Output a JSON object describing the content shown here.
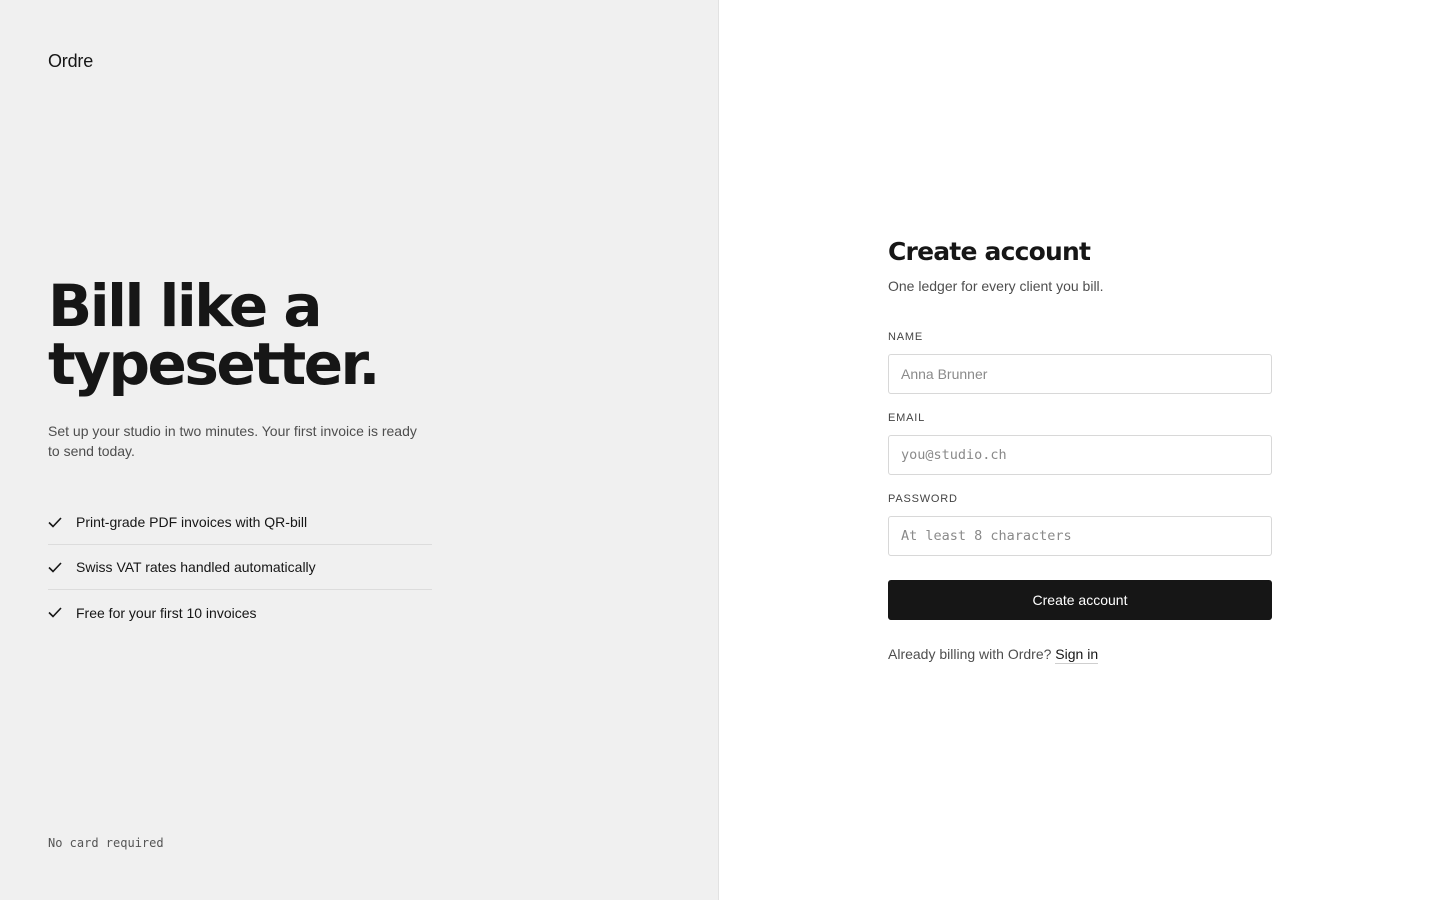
{
  "brand": {
    "name": "Ordre"
  },
  "hero": {
    "headline_line1": "Bill like a",
    "headline_line2": "typesetter.",
    "lede": "Set up your studio in two minutes. Your first invoice is ready to send today."
  },
  "features": [
    {
      "icon": "check-icon",
      "label": "Print-grade PDF invoices with QR-bill"
    },
    {
      "icon": "check-icon",
      "label": "Swiss VAT rates handled automatically"
    },
    {
      "icon": "check-icon",
      "label": "Free for your first 10 invoices"
    }
  ],
  "footnote": "No card required",
  "form": {
    "title": "Create account",
    "subtitle": "One ledger for every client you bill.",
    "name": {
      "label": "NAME",
      "placeholder": "Anna Brunner",
      "value": ""
    },
    "email": {
      "label": "EMAIL",
      "placeholder": "you@studio.ch",
      "value": ""
    },
    "password": {
      "label": "PASSWORD",
      "placeholder": "At least 8 characters",
      "value": ""
    },
    "submit_label": "Create account",
    "signin_prompt": "Already billing with Ordre?",
    "signin_link": "Sign in"
  },
  "colors": {
    "left_bg": "#f0f0f0",
    "right_bg": "#ffffff",
    "text_primary": "#161616",
    "text_secondary": "#4e4e4e",
    "button_bg": "#161616",
    "button_text": "#ffffff",
    "input_border": "#d8d8d8"
  }
}
